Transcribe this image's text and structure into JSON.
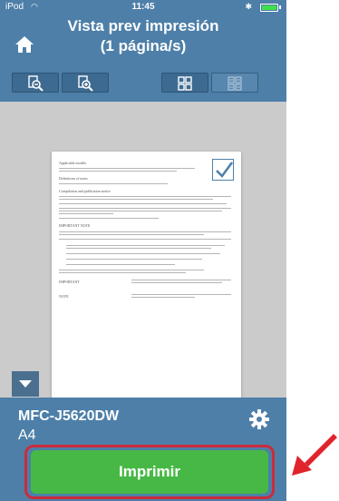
{
  "status_bar": {
    "carrier": "iPod",
    "time": "11:45"
  },
  "nav": {
    "title_line1": "Vista prev impresión",
    "title_line2": "(1 página/s)"
  },
  "toolbar": {
    "buttons": [
      "zoom-out-icon",
      "zoom-in-icon",
      "single-page-icon",
      "multi-page-icon"
    ]
  },
  "document": {
    "heading1": "Applicable models",
    "heading2": "Definitions of notes",
    "heading3": "Compilation and publication notice",
    "heading4": "IMPORTANT NOTE",
    "label_important": "IMPORTANT",
    "label_note": "NOTE"
  },
  "printer": {
    "name": "MFC-J5620DW",
    "paper": "A4"
  },
  "actions": {
    "print_label": "Imprimir"
  },
  "colors": {
    "header_blue": "#4d7fa8",
    "print_green": "#47b846",
    "highlight_red": "#cc2b3b"
  }
}
